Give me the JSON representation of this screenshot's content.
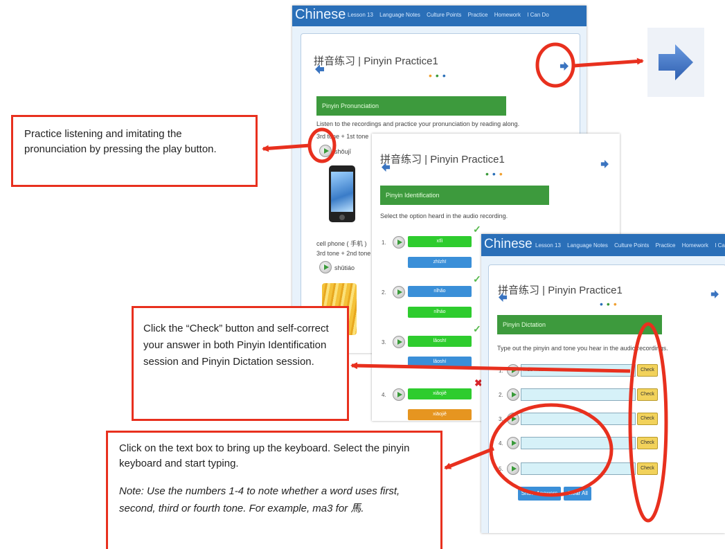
{
  "nav": {
    "brand": "Chinese",
    "links": [
      "Lesson 13",
      "Language Notes",
      "Culture Points",
      "Practice",
      "Homework",
      "I Can Do"
    ]
  },
  "page_title": "拼音练习 | Pinyin Practice1",
  "pronunciation": {
    "section": "Pinyin Pronunciation",
    "instruction": "Listen to the recordings and practice your pronunciation by reading along.",
    "tone_1": "3rd tone + 1st tone",
    "word_1": "shǒujī",
    "caption_1": "cell phone ( 手机 )",
    "tone_2": "3rd tone + 2nd tone",
    "word_2": "shǔtiáo"
  },
  "identification": {
    "section": "Pinyin Identification",
    "instruction": "Select the option heard in the audio recording.",
    "items": [
      {
        "num": "1.",
        "options": [
          "xīlì",
          "zhīzhī"
        ]
      },
      {
        "num": "2.",
        "options": [
          "nǐhǎo",
          "nǐháo"
        ]
      },
      {
        "num": "3.",
        "options": [
          "lǎoshī",
          "lǎoshí"
        ]
      },
      {
        "num": "4.",
        "options": [
          "xiǎojiě",
          "xiāojiě"
        ]
      }
    ]
  },
  "dictation": {
    "section": "Pinyin Dictation",
    "instruction": "Type out the pinyin and tone you hear in the audio recordings.",
    "rows": [
      {
        "num": "1.",
        "value": "ma3 ma1 ..."
      },
      {
        "num": "2.",
        "value": ""
      },
      {
        "num": "3.",
        "value": ""
      },
      {
        "num": "4.",
        "value": ""
      },
      {
        "num": "5.",
        "value": ""
      }
    ],
    "check_label": "Check",
    "show_answers": "Show Answers",
    "clear_all": "Clear All"
  },
  "callouts": {
    "play": "Practice listening and imitating the pronunciation by pressing the play button.",
    "check": "Click the “Check” button and self-correct your answer in both Pinyin Identification session and Pinyin Dictation session.",
    "keyboard": "Click on the text box to bring up the keyboard. Select the pinyin keyboard and start typing.",
    "note": "Note: Use the numbers 1-4 to note whether a word uses first, second, third or fourth tone. For example, ma3 for 馬."
  },
  "colors": {
    "annotation_red": "#e8301e",
    "nav_blue": "#2a6fb8",
    "section_green": "#3d9a3d",
    "check_yellow": "#f2d25b"
  },
  "icons": [
    "next-arrow-icon",
    "back-arrow-icon",
    "play-icon",
    "checkmark-icon",
    "cross-icon",
    "phone-image",
    "fries-image"
  ]
}
